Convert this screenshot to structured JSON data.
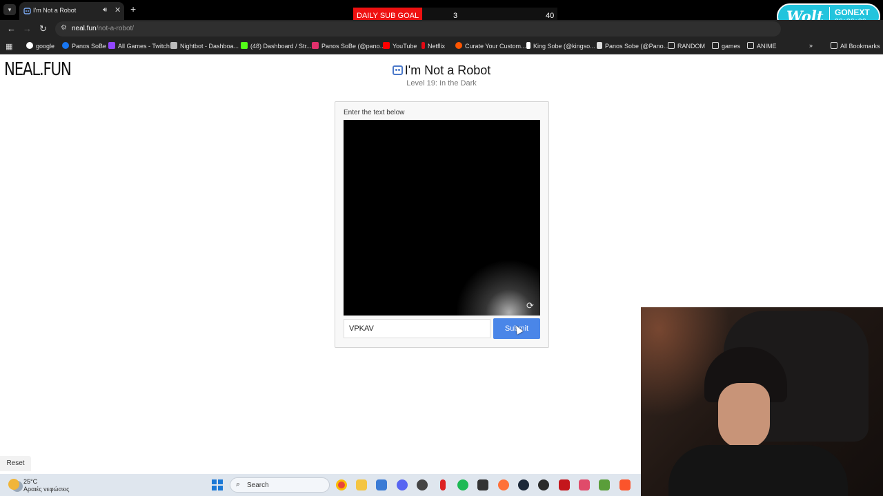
{
  "browser": {
    "tab_title": "I'm Not a Robot",
    "url_host": "neal.fun",
    "url_path": "/not-a-robot/",
    "bookmarks": [
      {
        "label": "google",
        "color": "#ffffff"
      },
      {
        "label": "Panos SoBe",
        "color": "#1877f2"
      },
      {
        "label": "All Games - Twitch",
        "color": "#9146ff"
      },
      {
        "label": "Nightbot - Dashboa...",
        "color": "#bbbbbb"
      },
      {
        "label": "(48) Dashboard / Str...",
        "color": "#53fc18"
      },
      {
        "label": "Panos SoBe (@pano...",
        "color": "#e1306c"
      },
      {
        "label": "YouTube",
        "color": "#ff0000"
      },
      {
        "label": "Netflix",
        "color": "#e50914"
      },
      {
        "label": "Curate Your Custom...",
        "color": "#ff5500"
      },
      {
        "label": "King Sobe (@kingso...",
        "color": "#ffffff"
      },
      {
        "label": "Panos Sobe (@Pano...",
        "color": "#ffffff"
      },
      {
        "label": "RANDOM",
        "color": "#dddddd"
      },
      {
        "label": "games",
        "color": "#dddddd"
      },
      {
        "label": "ANIME",
        "color": "#dddddd"
      }
    ],
    "all_bookmarks": "All Bookmarks"
  },
  "overlay": {
    "sub_goal_label": "DAILY SUB GOAL",
    "sub_goal_current": "3",
    "sub_goal_target": "40",
    "wolt_logo": "Wolt",
    "wolt_code": "GONEXT",
    "wolt_offer": "2€+2€+2€"
  },
  "page": {
    "brand": "NEAL.FUN",
    "title": "I'm Not a Robot",
    "level": "Level 19: In the Dark",
    "instruction": "Enter the text below",
    "answer_value": "VPKAV",
    "submit_label": "Submit",
    "reset_label": "Reset"
  },
  "taskbar": {
    "temperature": "25°C",
    "condition": "Αραιές νεφώσεις",
    "search_label": "Search",
    "apps": [
      {
        "name": "chrome-icon",
        "color": "#e8453c"
      },
      {
        "name": "files-icon",
        "color": "#f4c542"
      },
      {
        "name": "store-icon",
        "color": "#3a7bd5"
      },
      {
        "name": "discord-icon",
        "color": "#5865f2"
      },
      {
        "name": "obs-icon",
        "color": "#444444"
      },
      {
        "name": "red-app-icon",
        "color": "#d22"
      },
      {
        "name": "spotify-icon",
        "color": "#1db954"
      },
      {
        "name": "bm-icon",
        "color": "#333333"
      },
      {
        "name": "firefox-icon",
        "color": "#ff7139"
      },
      {
        "name": "steam-icon",
        "color": "#1b2838"
      },
      {
        "name": "4k-icon",
        "color": "#2b2b2b"
      },
      {
        "name": "app-red-icon",
        "color": "#c4161c"
      },
      {
        "name": "app-pink-icon",
        "color": "#e04b6a"
      },
      {
        "name": "minecraft-icon",
        "color": "#5a9e3a"
      },
      {
        "name": "brave-icon",
        "color": "#fb542b"
      }
    ]
  }
}
